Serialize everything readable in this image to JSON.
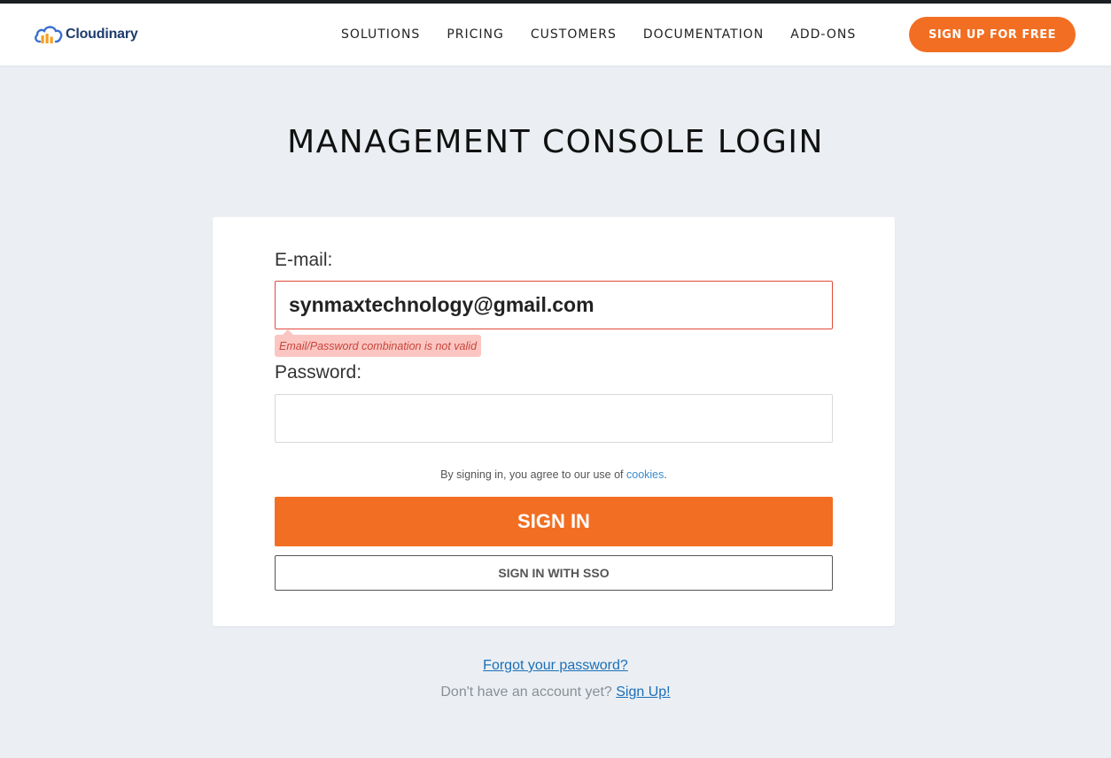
{
  "header": {
    "brand": "Cloudinary",
    "nav": [
      "SOLUTIONS",
      "PRICING",
      "CUSTOMERS",
      "DOCUMENTATION",
      "ADD-ONS"
    ],
    "signup_label": "SIGN UP FOR FREE"
  },
  "page": {
    "title": "MANAGEMENT CONSOLE LOGIN"
  },
  "form": {
    "email_label": "E-mail:",
    "email_value": "synmaxtechnology@gmail.com",
    "error_message": "Email/Password combination is not valid",
    "password_label": "Password:",
    "password_value": "",
    "agree_text": "By signing in, you agree to our use of",
    "cookies_link": "cookies",
    "agree_suffix": ".",
    "signin_label": "SIGN IN",
    "sso_label": "SIGN IN WITH SSO"
  },
  "footer": {
    "forgot_label": "Forgot your password?",
    "no_account_text": "Don't have an account yet?",
    "signup_link": "Sign Up!"
  },
  "colors": {
    "accent": "#f26e22",
    "error": "#e14b3b",
    "link": "#1a6fb8",
    "background": "#ebeff3"
  },
  "icons": {
    "logo": "cloudinary-logo-icon"
  }
}
